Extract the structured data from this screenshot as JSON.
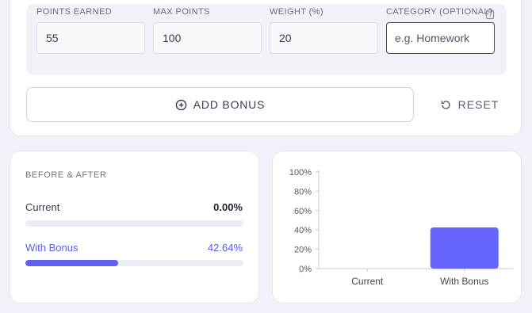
{
  "inputs": {
    "points_earned": {
      "label": "POINTS EARNED",
      "value": "55"
    },
    "max_points": {
      "label": "MAX POINTS",
      "value": "100"
    },
    "weight": {
      "label": "WEIGHT (%)",
      "value": "20"
    },
    "category": {
      "label": "CATEGORY (OPTIONAL)",
      "value": "",
      "placeholder": "e.g. Homework"
    }
  },
  "actions": {
    "add_bonus_label": "ADD BONUS",
    "reset_label": "RESET"
  },
  "before_after": {
    "title": "BEFORE & AFTER",
    "current": {
      "label": "Current",
      "value_text": "0.00%",
      "percent": 0
    },
    "with_bonus": {
      "label": "With Bonus",
      "value_text": "42.64%",
      "percent": 42.64
    }
  },
  "colors": {
    "accent": "#6060ee",
    "bar": "#6666ff",
    "track": "#ececf4"
  },
  "icons": [
    "clipboard-icon",
    "plus-circle-icon",
    "reset-icon"
  ],
  "chart_data": {
    "type": "bar",
    "categories": [
      "Current",
      "With Bonus"
    ],
    "values": [
      0,
      42.64
    ],
    "ylim": [
      0,
      100
    ],
    "yticks": [
      "0%",
      "20%",
      "40%",
      "60%",
      "80%",
      "100%"
    ],
    "grid": false
  }
}
